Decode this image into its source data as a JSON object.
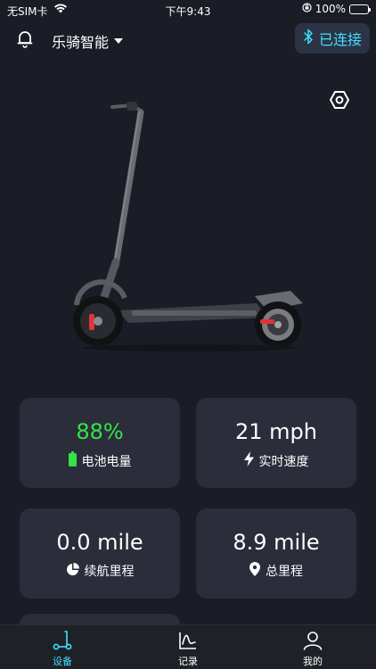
{
  "status_bar": {
    "carrier": "无SIM卡",
    "time": "下午9:43",
    "battery": "100%"
  },
  "header": {
    "brand": "乐骑智能",
    "connect_label": "已连接"
  },
  "stats": [
    {
      "value": "88%",
      "label": "电池电量",
      "icon": "battery-icon"
    },
    {
      "value": "21 mph",
      "label": "实时速度",
      "icon": "lightning-icon"
    },
    {
      "value": "0.0 mile",
      "label": "续航里程",
      "icon": "pie-chart-icon"
    },
    {
      "value": "8.9 mile",
      "label": "总里程",
      "icon": "location-pin-icon"
    }
  ],
  "tabs": [
    {
      "label": "设备",
      "icon": "scooter-icon",
      "active": true
    },
    {
      "label": "记录",
      "icon": "line-chart-icon",
      "active": false
    },
    {
      "label": "我的",
      "icon": "user-icon",
      "active": false
    }
  ],
  "colors": {
    "background": "#1a1c26",
    "card": "#2b2d3a",
    "accent": "#3ee0ff",
    "battery_green": "#33e34a"
  }
}
